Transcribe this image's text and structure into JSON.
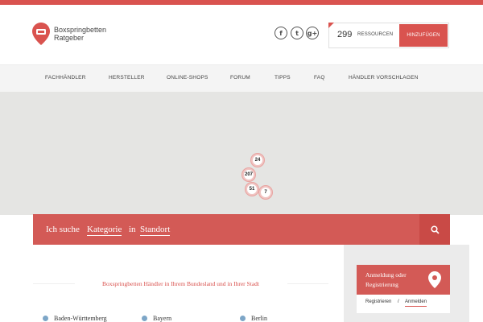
{
  "brand": {
    "name_line1": "Boxspringbetten",
    "name_line2": "Ratgeber"
  },
  "social": [
    {
      "glyph": "f",
      "icon": "facebook-icon"
    },
    {
      "glyph": "t",
      "icon": "twitter-icon"
    },
    {
      "glyph": "g+",
      "icon": "google-plus-icon"
    }
  ],
  "resources": {
    "count": "299",
    "label": "RESSOURCEN",
    "button": "HINZUFÜGEN"
  },
  "nav": {
    "items": [
      "FACHHÄNDLER",
      "HERSTELLER",
      "ONLINE-SHOPS",
      "FORUM",
      "TIPPS",
      "FAQ",
      "HÄNDLER VORSCHLAGEN"
    ]
  },
  "map": {
    "clusters": [
      "24",
      "207",
      "51",
      "7"
    ]
  },
  "search": {
    "prefix": "Ich suche",
    "category": "Kategorie",
    "joiner": "in",
    "location": "Standort"
  },
  "section": {
    "title": "Boxspringbetten Händler in Ihrem Bundesland und in Ihrer Stadt"
  },
  "states": [
    "Baden-Württemberg",
    "Bayern",
    "Berlin"
  ],
  "login": {
    "title": "Anmeldung oder Registrierung",
    "tab_register": "Registrieren",
    "separator": "/",
    "tab_login": "Anmelden"
  },
  "colors": {
    "accent": "#d9534f",
    "map_bg": "#e5e5e3",
    "nav_bg": "#f4f4f4"
  }
}
